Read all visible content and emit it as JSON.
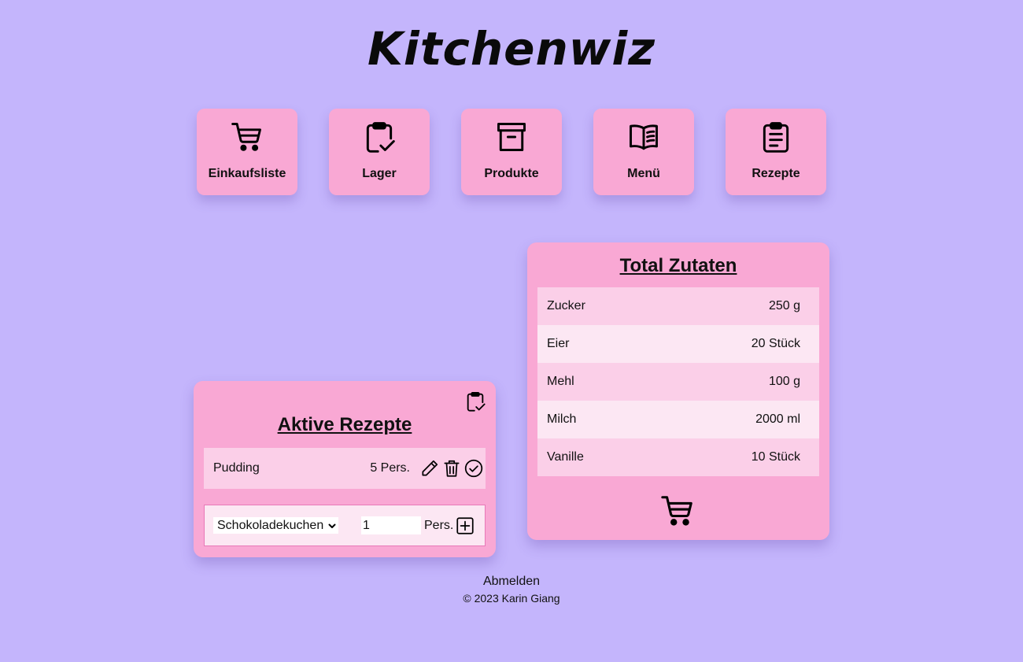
{
  "app": {
    "title": "Kitchenwiz"
  },
  "nav": [
    {
      "label": "Einkaufsliste",
      "icon": "shopping-cart-icon"
    },
    {
      "label": "Lager",
      "icon": "clipboard-check-icon"
    },
    {
      "label": "Produkte",
      "icon": "archive-box-icon"
    },
    {
      "label": "Menü",
      "icon": "open-book-icon"
    },
    {
      "label": "Rezepte",
      "icon": "clipboard-list-icon"
    }
  ],
  "active_recipes": {
    "title": "Aktive Rezepte",
    "items": [
      {
        "name": "Pudding",
        "persons": "5 Pers."
      }
    ],
    "add_form": {
      "selected_recipe": "Schokoladekuchen",
      "quantity": "1",
      "persons_label": "Pers."
    }
  },
  "total_ingredients": {
    "title": "Total Zutaten",
    "items": [
      {
        "name": "Zucker",
        "amount": "250 g"
      },
      {
        "name": "Eier",
        "amount": "20 Stück"
      },
      {
        "name": "Mehl",
        "amount": "100 g"
      },
      {
        "name": "Milch",
        "amount": "2000 ml"
      },
      {
        "name": "Vanille",
        "amount": "10 Stück"
      }
    ]
  },
  "footer": {
    "logout": "Abmelden",
    "copyright": "© 2023 Karin Giang"
  }
}
